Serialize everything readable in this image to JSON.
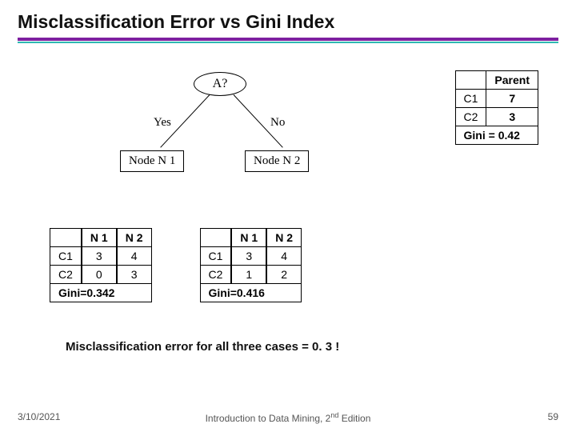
{
  "title": "Misclassification Error vs Gini Index",
  "tree": {
    "root": "A?",
    "yes": "Yes",
    "no": "No",
    "node1": "Node N 1",
    "node2": "Node N 2"
  },
  "parent_table": {
    "header_blank": "",
    "header_label": "Parent",
    "rows": [
      {
        "label": "C1",
        "value": "7"
      },
      {
        "label": "C2",
        "value": "3"
      }
    ],
    "footer_label": "Gini = 0.42"
  },
  "split_tables": [
    {
      "cols": [
        "N 1",
        "N 2"
      ],
      "rows": [
        {
          "label": "C1",
          "vals": [
            "3",
            "4"
          ]
        },
        {
          "label": "C2",
          "vals": [
            "0",
            "3"
          ]
        }
      ],
      "footer": "Gini=0.342"
    },
    {
      "cols": [
        "N 1",
        "N 2"
      ],
      "rows": [
        {
          "label": "C1",
          "vals": [
            "3",
            "4"
          ]
        },
        {
          "label": "C2",
          "vals": [
            "1",
            "2"
          ]
        }
      ],
      "footer": "Gini=0.416"
    }
  ],
  "note": "Misclassification error for all three cases = 0. 3 !",
  "footer": {
    "date": "3/10/2021",
    "center_pre": "Introduction to Data Mining, 2",
    "center_sup": "nd",
    "center_post": " Edition",
    "page": "59"
  },
  "chart_data": {
    "type": "table",
    "title": "Misclassification Error vs Gini Index",
    "parent": {
      "C1": 7,
      "C2": 3,
      "gini": 0.42
    },
    "splits": [
      {
        "N1": {
          "C1": 3,
          "C2": 0
        },
        "N2": {
          "C1": 4,
          "C2": 3
        },
        "gini": 0.342
      },
      {
        "N1": {
          "C1": 3,
          "C2": 1
        },
        "N2": {
          "C1": 4,
          "C2": 2
        },
        "gini": 0.416
      }
    ],
    "misclassification_error": 0.3
  }
}
